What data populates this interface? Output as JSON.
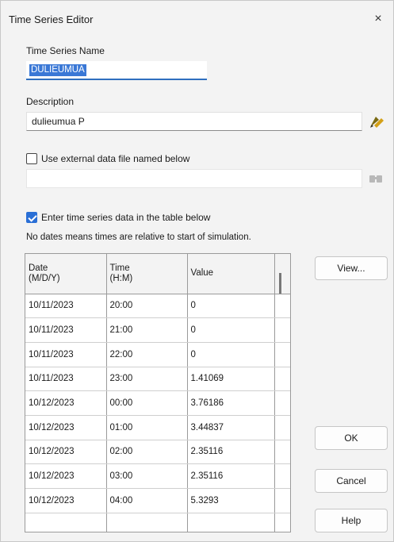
{
  "window": {
    "title": "Time Series Editor",
    "close_glyph": "×"
  },
  "name": {
    "label": "Time Series Name",
    "value": "DULIEUMUA"
  },
  "description": {
    "label": "Description",
    "value": "dulieumua P",
    "edit_icon": "pencil-edit-icon"
  },
  "external_file": {
    "label": "Use external data file named below",
    "checked": false,
    "value": "",
    "browse_icon": "folder-browse-icon"
  },
  "table_option": {
    "label": "Enter time series data in the table below",
    "checked": true
  },
  "note": "No dates means times are relative to start of simulation.",
  "table": {
    "headers": [
      {
        "line1": "Date",
        "line2": "(M/D/Y)"
      },
      {
        "line1": "Time",
        "line2": "(H:M)"
      },
      {
        "line1": "Value",
        "line2": ""
      }
    ],
    "rows": [
      {
        "date": "10/11/2023",
        "time": "20:00",
        "value": "0"
      },
      {
        "date": "10/11/2023",
        "time": "21:00",
        "value": "0"
      },
      {
        "date": "10/11/2023",
        "time": "22:00",
        "value": "0"
      },
      {
        "date": "10/11/2023",
        "time": "23:00",
        "value": "1.41069"
      },
      {
        "date": "10/12/2023",
        "time": "00:00",
        "value": "3.76186"
      },
      {
        "date": "10/12/2023",
        "time": "01:00",
        "value": "3.44837"
      },
      {
        "date": "10/12/2023",
        "time": "02:00",
        "value": "2.35116"
      },
      {
        "date": "10/12/2023",
        "time": "03:00",
        "value": "2.35116"
      },
      {
        "date": "10/12/2023",
        "time": "04:00",
        "value": "5.3293"
      },
      {
        "date": "",
        "time": "",
        "value": ""
      }
    ]
  },
  "buttons": {
    "view": "View...",
    "ok": "OK",
    "cancel": "Cancel",
    "help": "Help"
  }
}
